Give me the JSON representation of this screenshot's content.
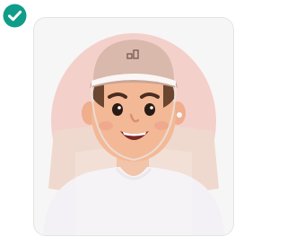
{
  "status": {
    "icon": "checkmark-circle-icon",
    "color": "#0f9d8a",
    "state": "verified"
  },
  "photo": {
    "subject": "avatar-icon",
    "frame_color": "#f3c9c3",
    "card_background": "#f6f6f6"
  }
}
